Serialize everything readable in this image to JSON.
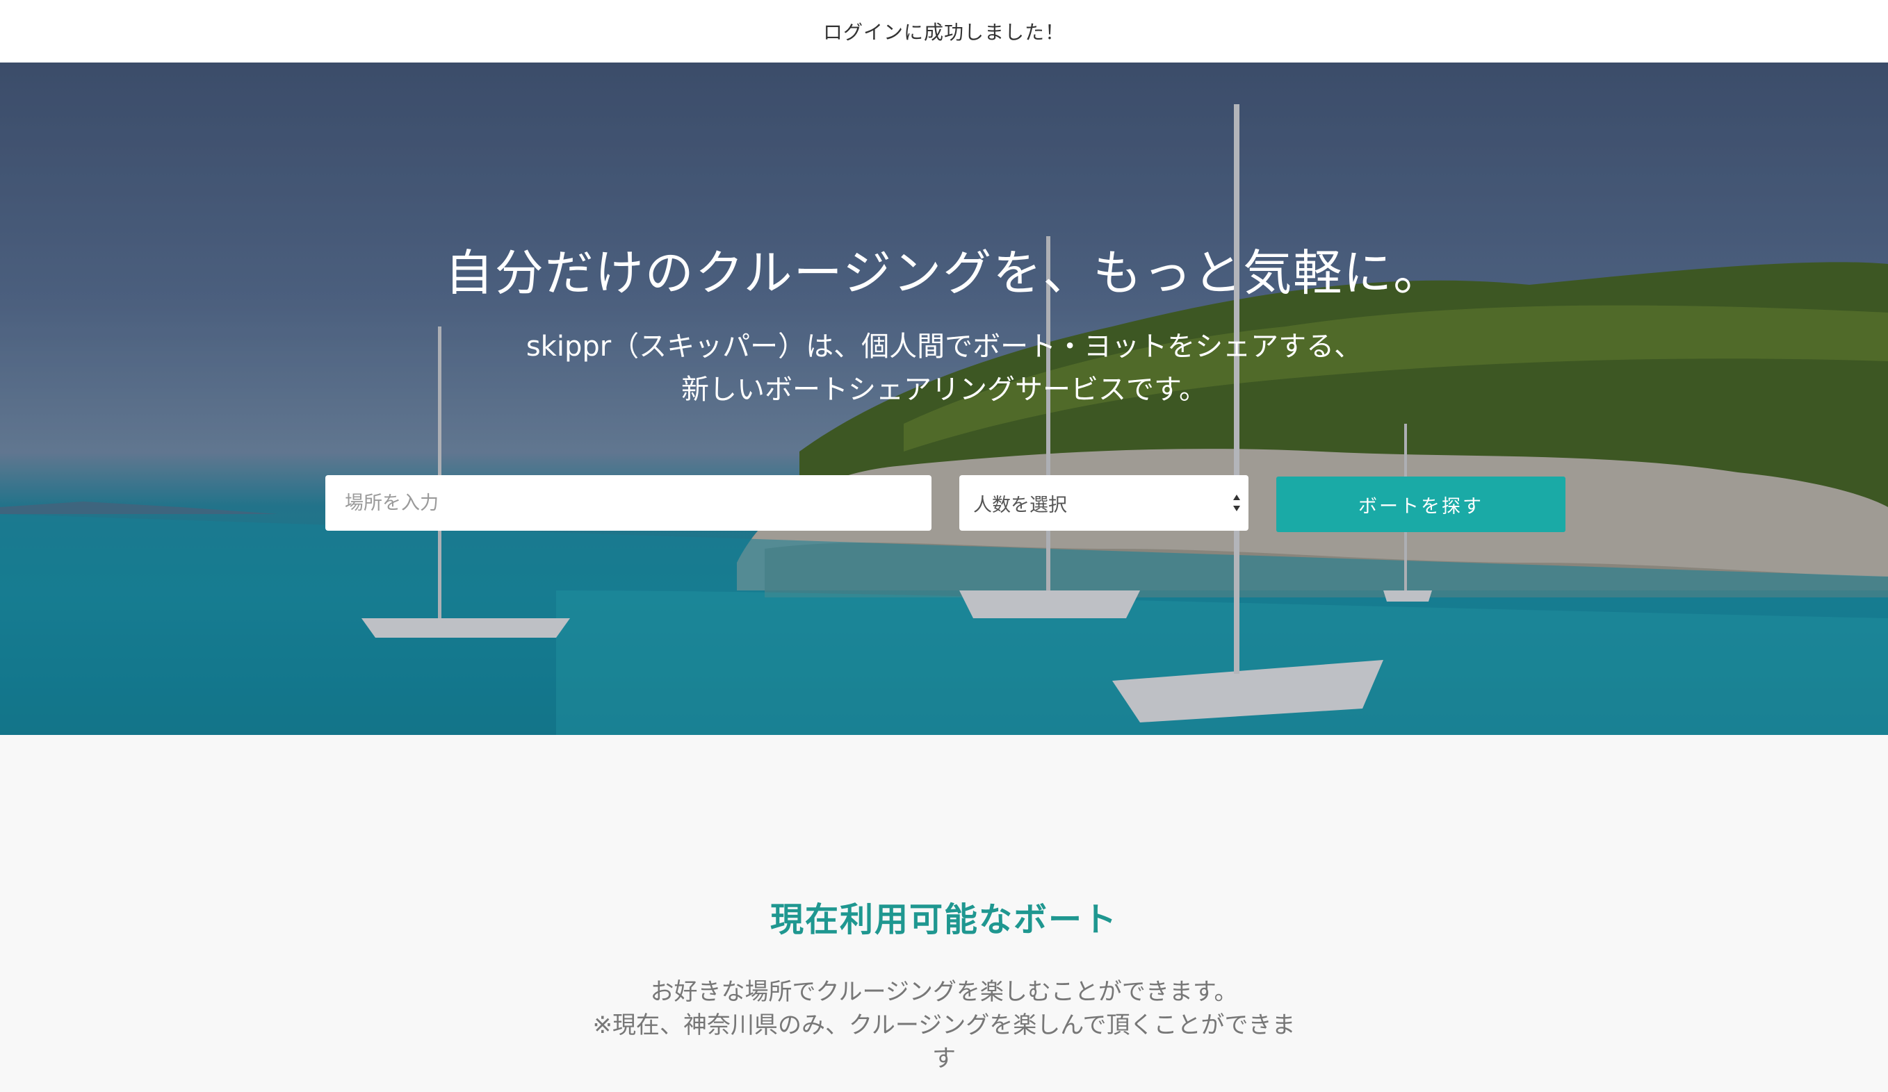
{
  "flash": {
    "message": "ログインに成功しました！"
  },
  "hero": {
    "headline": "自分だけのクルージングを、もっと気軽に。",
    "subline_1": "skippr（スキッパー）は、個人間でボート・ヨットをシェアする、",
    "subline_2": "新しいボートシェアリングサービスです。",
    "search": {
      "place_placeholder": "場所を入力",
      "people_selected": "人数を選択",
      "button_label": "ボートを探す"
    }
  },
  "boats_section": {
    "title": "現在利用可能なボート",
    "desc_line_1": "お好きな場所でクルージングを楽しむことができます。",
    "desc_line_2": "※現在、神奈川県のみ、クルージングを楽しんで頂くことができま",
    "desc_line_3": "す"
  },
  "colors": {
    "accent": "#1aaaa6",
    "title": "#1f9790",
    "muted_text": "#777777"
  }
}
